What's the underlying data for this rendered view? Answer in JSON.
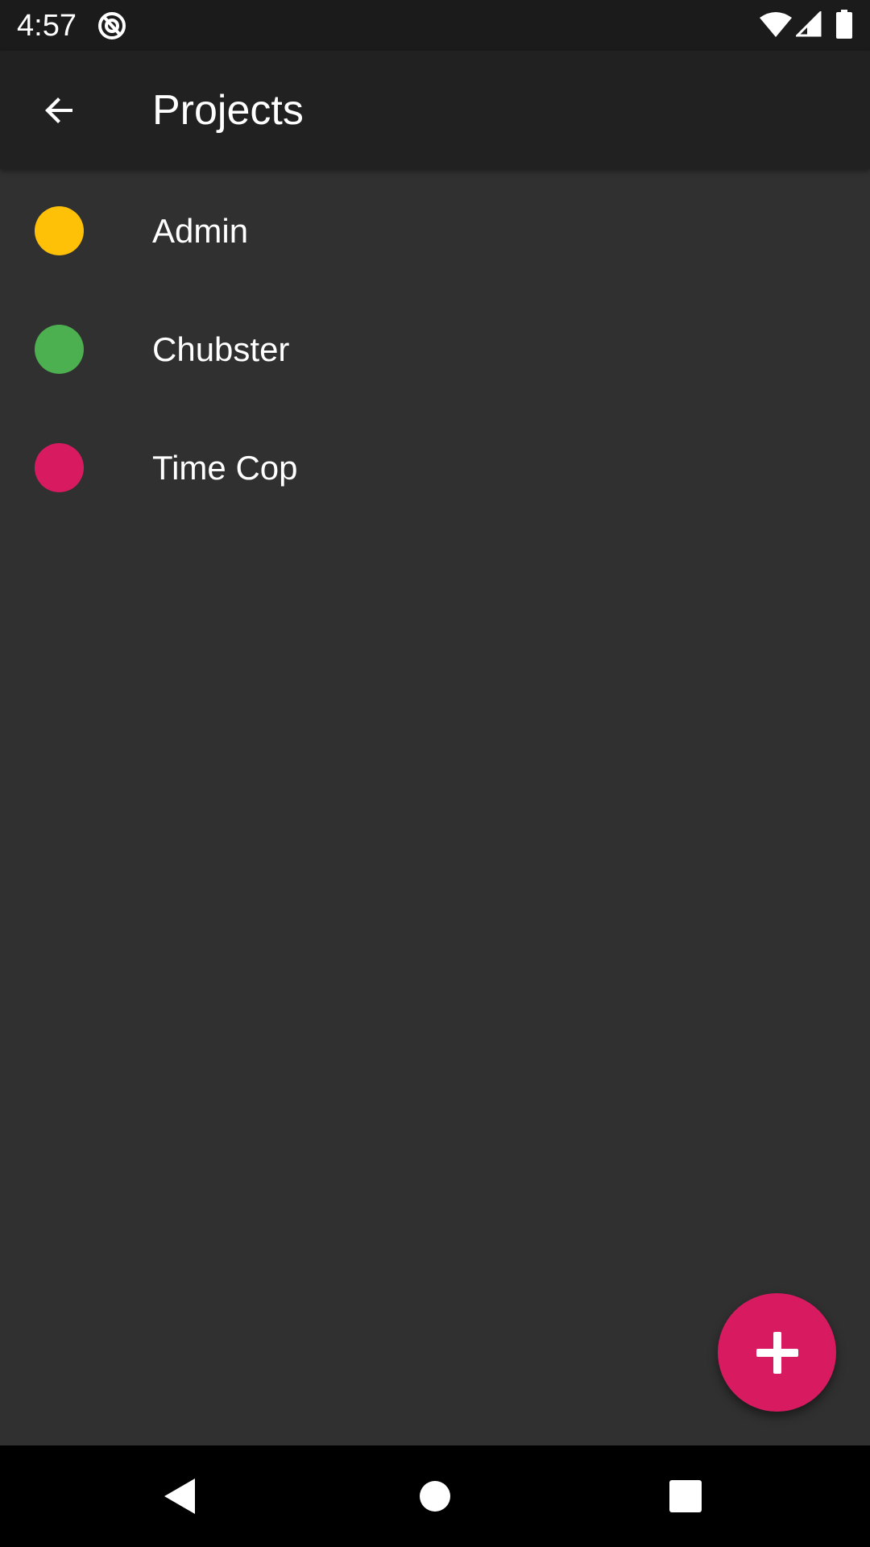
{
  "status_bar": {
    "time": "4:57",
    "icons": [
      "app-notification-icon",
      "wifi-icon",
      "cell-signal-icon",
      "battery-icon"
    ]
  },
  "app_bar": {
    "title": "Projects",
    "back_icon": "arrow-back-icon"
  },
  "projects": [
    {
      "name": "Admin",
      "color": "#FFC107"
    },
    {
      "name": "Chubster",
      "color": "#4CAF50"
    },
    {
      "name": "Time Cop",
      "color": "#D81B60"
    }
  ],
  "fab": {
    "icon": "plus-icon",
    "color": "#D81B60"
  },
  "nav_bar": {
    "icons": [
      "nav-back-icon",
      "nav-home-icon",
      "nav-recents-icon"
    ]
  },
  "colors": {
    "background": "#303030",
    "app_bar": "#212121",
    "status_bar": "#1B1B1B",
    "nav_bar": "#000000",
    "accent": "#D81B60"
  }
}
